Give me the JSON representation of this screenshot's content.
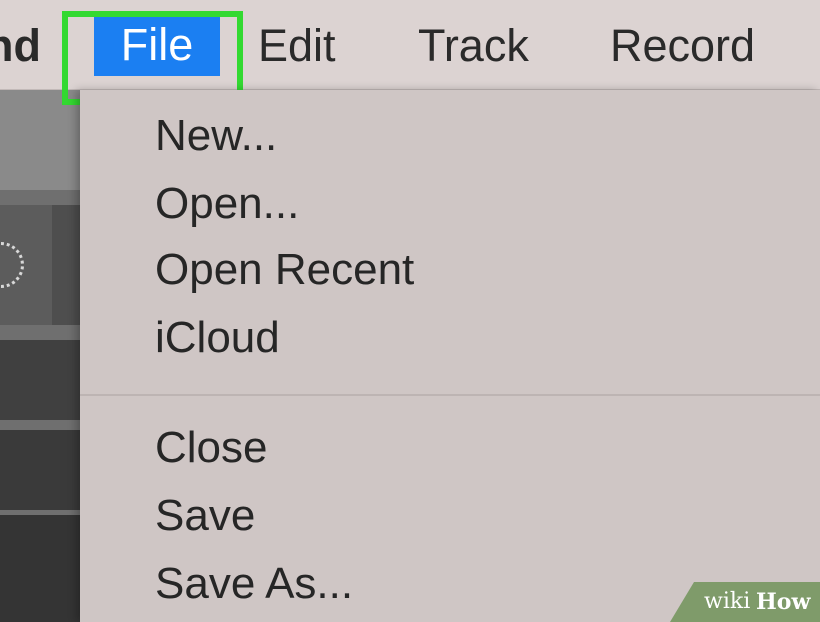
{
  "menubar": {
    "app_label": "nd",
    "items": [
      {
        "label": "File",
        "selected": true
      },
      {
        "label": "Edit"
      },
      {
        "label": "Track"
      },
      {
        "label": "Record"
      }
    ]
  },
  "file_menu": {
    "items": [
      "New...",
      "Open...",
      "Open Recent",
      "iCloud",
      "Close",
      "Save",
      "Save As..."
    ]
  },
  "watermark": {
    "wiki": "wiki",
    "how": "How"
  },
  "colors": {
    "selected_menu": "#1b7ff2",
    "highlight_box": "#33d931",
    "watermark": "#7f9b6a"
  }
}
